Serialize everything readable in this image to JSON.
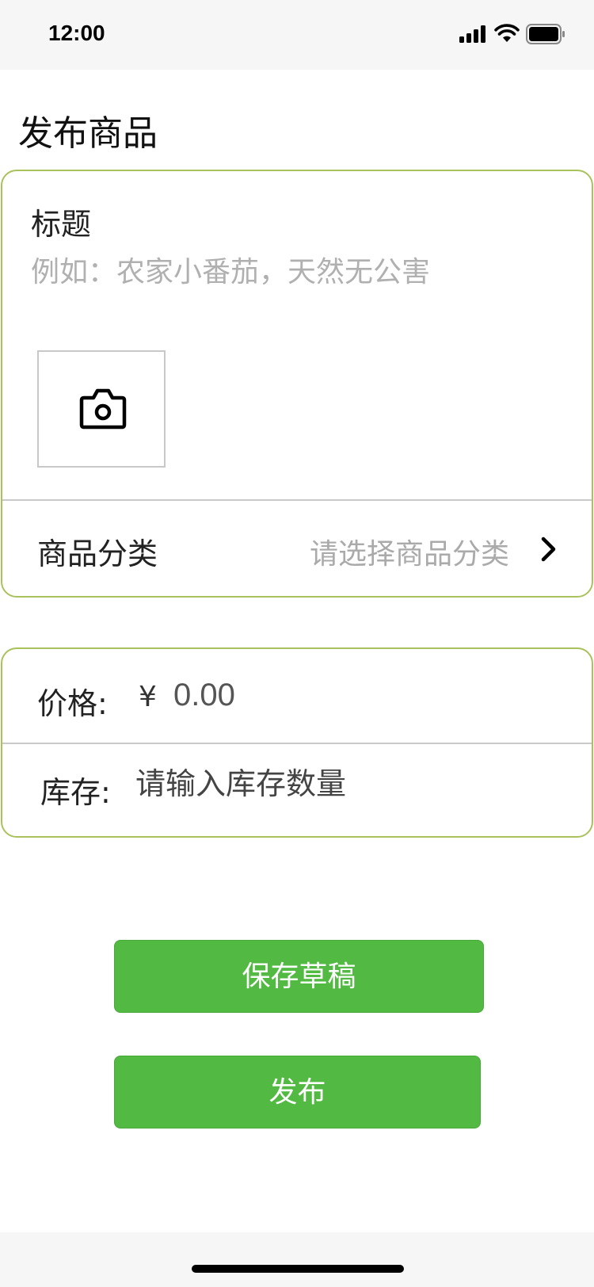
{
  "status_bar": {
    "time": "12:00"
  },
  "page": {
    "title": "发布商品"
  },
  "product_form": {
    "title_label": "标题",
    "title_placeholder": "例如：农家小番茄，天然无公害",
    "photo_upload_icon": "camera-icon",
    "category_label": "商品分类",
    "category_placeholder": "请选择商品分类",
    "category_chevron_icon": "chevron-right-icon"
  },
  "pricing": {
    "price_label": "价格:",
    "currency_symbol": "¥",
    "price_value": "0.00",
    "stock_label": "库存:",
    "stock_placeholder": "请输入库存数量"
  },
  "actions": {
    "save_draft_label": "保存草稿",
    "publish_label": "发布"
  },
  "colors": {
    "accent_green": "#52ba42",
    "card_border": "#a9c25c"
  }
}
